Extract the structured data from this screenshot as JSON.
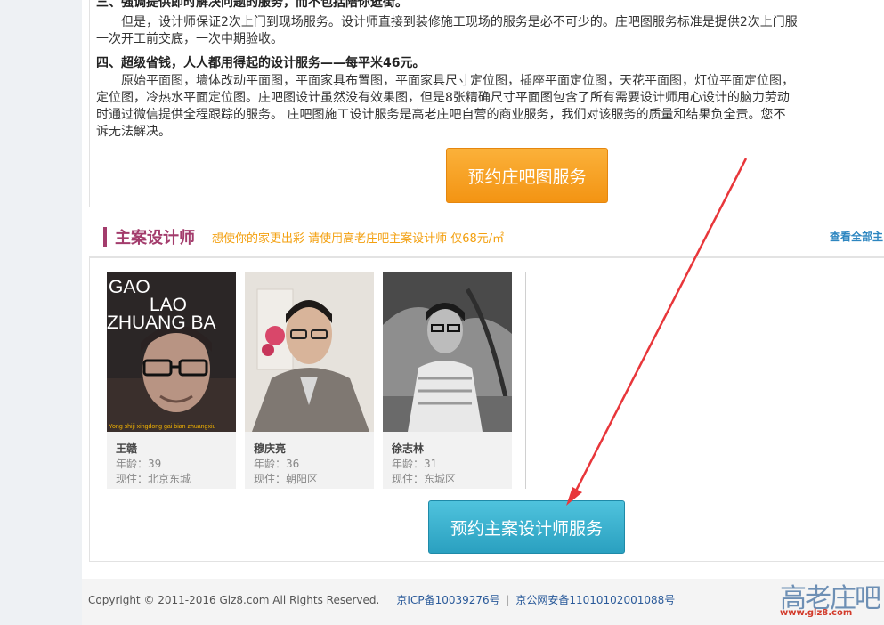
{
  "article": {
    "sec3_heading": "三、强调提供即时解决问题的服务，而不包括陪你逛街。",
    "sec3_p1": "但是，设计师保证2次上门到现场服务。设计师直接到装修施工现场的服务是必不可少的。庄吧图服务标准是提供2次上门服",
    "sec3_p2": "一次开工前交底，一次中期验收。",
    "sec4_heading": "四、超级省钱，人人都用得起的设计服务——每平米46元。",
    "sec4_p1": "原始平面图，墙体改动平面图，平面家具布置图，平面家具尺寸定位图，插座平面定位图，天花平面图，灯位平面定位图，",
    "sec4_p2": "定位图，冷热水平面定位图。庄吧图设计虽然没有效果图，但是8张精确尺寸平面图包含了所有需要设计师用心设计的脑力劳动",
    "sec4_p3": "时通过微信提供全程跟踪的服务。 庄吧图施工设计服务是高老庄吧自营的商业服务，我们对该服务的质量和结果负全责。您不",
    "sec4_p4": "诉无法解决。",
    "book_button": "预约庄吧图服务"
  },
  "designers": {
    "title": "主案设计师",
    "subtitle": "想使你的家更出彩 请使用高老庄吧主案设计师 仅68元/㎡",
    "view_all": "查看全部主",
    "photo_text": {
      "line1": "GAO",
      "line2": "LAO",
      "line3": "ZHUANG BA",
      "caption": "Yong shiji xingdong gai bian zhuangxiu"
    },
    "cards": [
      {
        "name": "王赣",
        "age": "年龄：39",
        "location": "现住：北京东城"
      },
      {
        "name": "穆庆亮",
        "age": "年龄：36",
        "location": "现住：朝阳区"
      },
      {
        "name": "徐志林",
        "age": "年龄：31",
        "location": "现住：东城区"
      }
    ],
    "book_button": "预约主案设计师服务"
  },
  "footer": {
    "copyright": "Copyright © 2011-2016 Glz8.com All Rights Reserved.",
    "icp": "京ICP备10039276号",
    "sep": "|",
    "police": "京公网安备11010102001088号"
  },
  "watermark": {
    "text": "高老庄吧",
    "url": "www.glz8.com"
  },
  "colors": {
    "accent_purple": "#a33c6c",
    "orange_button": "#f39413",
    "teal_button": "#2aa0c0",
    "arrow_red": "#e8363a"
  },
  "icons": {
    "annotation": "red-arrow"
  }
}
